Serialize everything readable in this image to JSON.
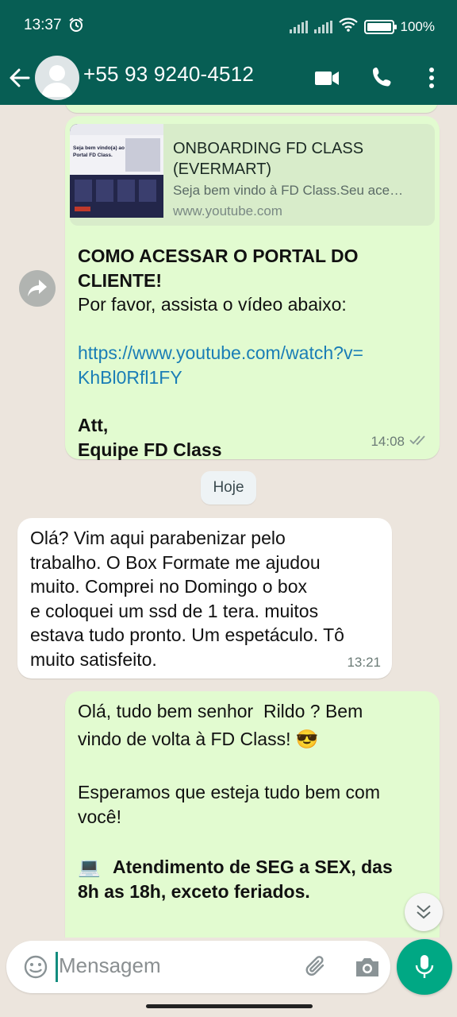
{
  "status_bar": {
    "time": "13:37",
    "battery": "100%"
  },
  "header": {
    "contact": "+55 93 9240-4512"
  },
  "messages": {
    "m1": {
      "preview_title": "ONBOARDING FD CLASS\n(EVERMART)",
      "preview_desc": "Seja bem vindo à FD Class.Seu ace…",
      "preview_domain": "www.youtube.com",
      "thumb_text": "Seja bem vindo(a) ao\nPortal FD Class.",
      "heading": "COMO ACESSAR O PORTAL DO\nCLIENTE!",
      "line1": "Por favor, assista o vídeo abaixo:",
      "link": "https://www.youtube.com/watch?v=\nKhBl0Rfl1FY",
      "signoff": "Att,\nEquipe FD Class",
      "time": "14:08"
    },
    "date_chip": "Hoje",
    "m2": {
      "text": "Olá? Vim aqui parabenizar pelo\ntrabalho. O Box Formate me ajudou\nmuito. Comprei no Domingo o box\ne coloquei um ssd de 1 tera. muitos\nestava tudo pronto. Um espetáculo. Tô\nmuito satisfeito.",
      "time": "13:21"
    },
    "m3": {
      "greeting": "Olá, tudo bem senhor  Rildo ? Bem\nvindo de volta à FD Class! 😎",
      "line2": "Esperamos que esteja tudo bem com\nvocê!",
      "hours_icon": "💻",
      "hours": "Atendimento de SEG a SEX, das\n8h as 18h, exceto feriados."
    }
  },
  "composer": {
    "placeholder": "Mensagem"
  },
  "colors": {
    "header": "#075e54",
    "outgoing_bubble": "#e2fbd0",
    "incoming_bubble": "#ffffff",
    "link": "#1a7eb6",
    "mic_button": "#00a884",
    "chat_background": "#ece5dd"
  },
  "icons": {
    "back": "arrow-left-icon",
    "video_call": "video-camera-icon",
    "voice_call": "phone-icon",
    "menu": "more-vertical-icon",
    "forward": "forward-arrow-icon",
    "read": "double-check-icon",
    "scroll_down": "double-chevron-down-icon",
    "emoji": "emoji-icon",
    "attach": "paperclip-icon",
    "camera": "camera-icon",
    "mic": "microphone-icon"
  }
}
